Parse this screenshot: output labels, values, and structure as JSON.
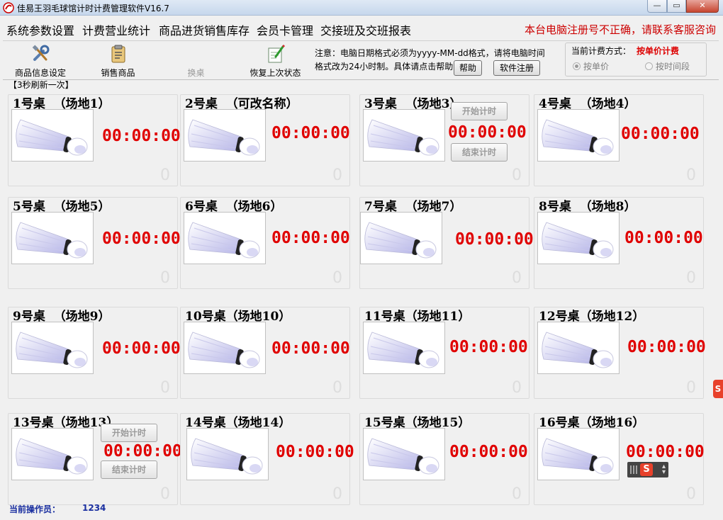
{
  "window": {
    "title": "佳易王羽毛球馆计时计费管理软件V16.7",
    "min_label": "—",
    "max_label": "▭",
    "close_label": "✕"
  },
  "menu": {
    "items": [
      "系统参数设置",
      "计费营业统计",
      "商品进货销售库存",
      "会员卡管理",
      "交接班及交班报表"
    ],
    "warning": "本台电脑注册号不正确，请联系客服咨询"
  },
  "toolbar": {
    "buttons": [
      {
        "label": "商品信息设定",
        "icon": "tools-icon"
      },
      {
        "label": "销售商品",
        "icon": "clipboard-icon"
      },
      {
        "label": "换桌",
        "icon": "swap-icon"
      },
      {
        "label": "恢复上次状态",
        "icon": "restore-icon"
      }
    ],
    "notice_line1": "注意：电脑日期格式必须为yyyy-MM-dd格式，请将电脑时间",
    "notice_line2": "格式改为24小时制。具体请点击帮助",
    "help_label": "帮助",
    "register_label": "软件注册",
    "billing_label": "当前计费方式：",
    "billing_value": "按单价计费",
    "billing_options": [
      "按单价",
      "按时间段"
    ],
    "billing_selected": "按单价"
  },
  "refresh_note": "【3秒刷新一次】",
  "tables": [
    {
      "name": "1号桌  （场地1）",
      "timer": "00:00:00",
      "count": "0"
    },
    {
      "name": "2号桌  （可改名称）",
      "timer": "00:00:00",
      "count": "0"
    },
    {
      "name": "3号桌  （场地3）",
      "timer": "00:00:00",
      "count": "0",
      "start_label": "开始计时",
      "end_label": "结束计时"
    },
    {
      "name": "4号桌  （场地4）",
      "timer": "00:00:00",
      "count": "0"
    },
    {
      "name": "5号桌  （场地5）",
      "timer": "00:00:00",
      "count": "0"
    },
    {
      "name": "6号桌  （场地6）",
      "timer": "00:00:00",
      "count": "0"
    },
    {
      "name": "7号桌  （场地7）",
      "timer": "00:00:00",
      "count": "0"
    },
    {
      "name": "8号桌  （场地8）",
      "timer": "00:00:00",
      "count": "0"
    },
    {
      "name": "9号桌  （场地9）",
      "timer": "00:00:00",
      "count": "0"
    },
    {
      "name": "10号桌（场地10）",
      "timer": "00:00:00",
      "count": "0"
    },
    {
      "name": "11号桌（场地11）",
      "timer": "00:00:00",
      "count": "0"
    },
    {
      "name": "12号桌（场地12）",
      "timer": "00:00:00",
      "count": "0"
    },
    {
      "name": "13号桌（场地13）",
      "timer": "00:00:00",
      "count": "0",
      "start_label": "开始计时",
      "end_label": "结束计时"
    },
    {
      "name": "14号桌（场地14）",
      "timer": "00:00:00",
      "count": "0"
    },
    {
      "name": "15号桌（场地15）",
      "timer": "00:00:00",
      "count": "0"
    },
    {
      "name": "16号桌（场地16）",
      "timer": "00:00:00",
      "count": "0"
    }
  ],
  "status": {
    "operator_label": "当前操作员：",
    "operator_value": "1234"
  },
  "colors": {
    "timer": "#e00000",
    "warning": "#cc0000",
    "billing_value": "#dd0000",
    "status_text": "#1a2fa0"
  }
}
